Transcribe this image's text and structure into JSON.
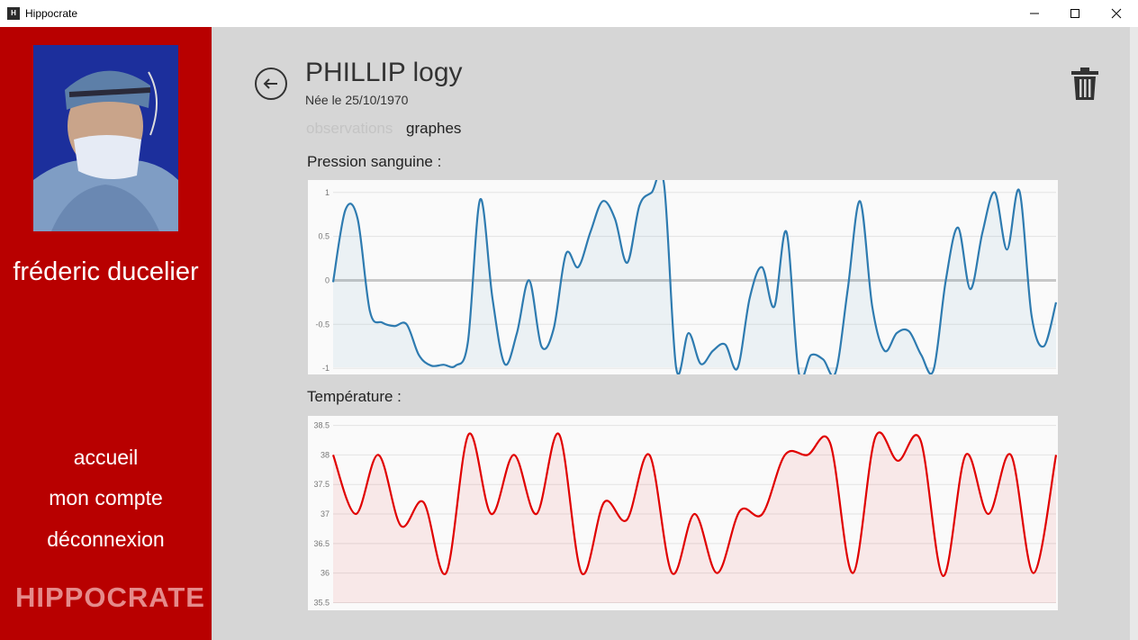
{
  "window": {
    "title": "Hippocrate",
    "icon_text": "H"
  },
  "sidebar": {
    "user_name": "fréderic ducelier",
    "nav": [
      {
        "label": "accueil"
      },
      {
        "label": "mon compte"
      },
      {
        "label": "déconnexion"
      }
    ],
    "logo": "HIPPOCRATE"
  },
  "patient": {
    "name": "PHILLIP logy",
    "birth": "Née le 25/10/1970"
  },
  "tabs": [
    {
      "label": "observations",
      "active": false
    },
    {
      "label": "graphes",
      "active": true
    }
  ],
  "colors": {
    "sidebar": "#b80000",
    "blood_pressure": "#2e7bb0",
    "temperature": "#e00000"
  },
  "sections": {
    "pressure_label": "Pression sanguine :",
    "temperature_label": "Température :"
  },
  "chart_data": [
    {
      "type": "area",
      "title": "",
      "yticks": [
        "1",
        "0.5",
        "0",
        "-0.5",
        "-1"
      ],
      "ylim": [
        -1.05,
        1.1
      ],
      "x": [
        0,
        1,
        2,
        3,
        4,
        5,
        6,
        7,
        8,
        9,
        10,
        11,
        12,
        13,
        14,
        15,
        16,
        17,
        18,
        19,
        20,
        21,
        22,
        23,
        24,
        25,
        26,
        27,
        28,
        29,
        30,
        31,
        32,
        33,
        34,
        35,
        36,
        37,
        38,
        39,
        40,
        41,
        42,
        43,
        44,
        45,
        46,
        47,
        48,
        49,
        50,
        51,
        52,
        53,
        54,
        55,
        56,
        57,
        58,
        59,
        60,
        61,
        62,
        63,
        64,
        65,
        66,
        67,
        68,
        69,
        70,
        71,
        72,
        73,
        74
      ],
      "values": [
        -0.02,
        0.8,
        0.7,
        -0.35,
        -0.48,
        -0.52,
        -0.5,
        -0.85,
        -0.97,
        -0.96,
        -0.97,
        -0.7,
        0.92,
        -0.2,
        -0.95,
        -0.6,
        0.0,
        -0.75,
        -0.55,
        0.3,
        0.15,
        0.55,
        0.9,
        0.7,
        0.2,
        0.85,
        1.0,
        1.1,
        -1.0,
        -0.6,
        -0.95,
        -0.8,
        -0.73,
        -1.0,
        -0.2,
        0.15,
        -0.3,
        0.55,
        -1.05,
        -0.85,
        -0.9,
        -1.05,
        -0.1,
        0.9,
        -0.3,
        -0.8,
        -0.6,
        -0.58,
        -0.85,
        -1.02,
        0.0,
        0.6,
        -0.1,
        0.55,
        1.0,
        0.35,
        1.02,
        -0.4,
        -0.75,
        -0.25
      ],
      "color": "#2e7bb0"
    },
    {
      "type": "area",
      "title": "",
      "yticks": [
        "38.5",
        "38",
        "37.5",
        "37",
        "36.5",
        "36",
        "35.5"
      ],
      "ylim": [
        35.4,
        38.6
      ],
      "values": [
        38.0,
        37.0,
        38.0,
        36.8,
        37.2,
        36.0,
        38.35,
        37.0,
        38.0,
        37.0,
        38.35,
        36.0,
        37.2,
        36.9,
        38.0,
        36.0,
        37.0,
        36.0,
        37.05,
        37.0,
        38.0,
        38.0,
        38.2,
        36.0,
        38.3,
        37.9,
        38.25,
        35.95,
        38.0,
        37.0,
        38.0,
        36.0,
        38.0
      ],
      "color": "#e00000"
    }
  ]
}
